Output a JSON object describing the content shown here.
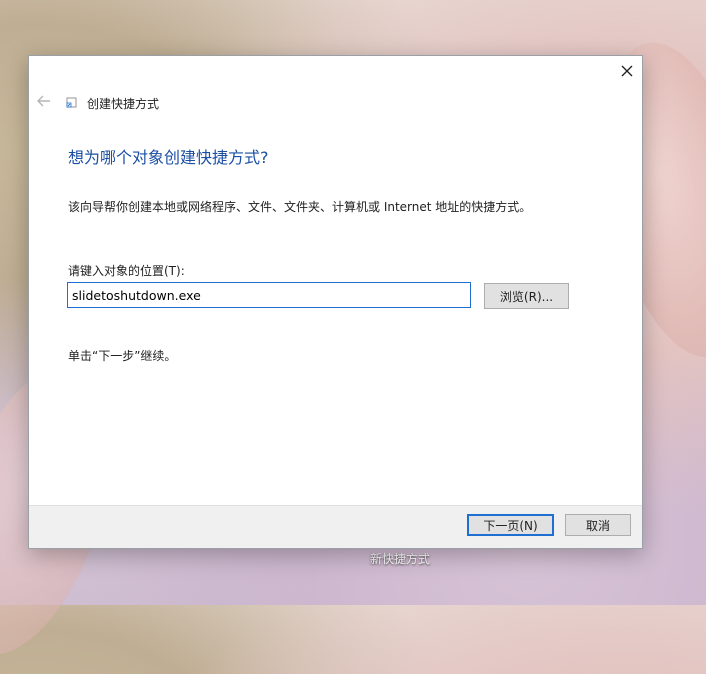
{
  "dialog": {
    "title": "创建快捷方式",
    "heading": "想为哪个对象创建快捷方式?",
    "description": "该向导帮你创建本地或网络程序、文件、文件夹、计算机或 Internet 地址的快捷方式。",
    "field_label": "请键入对象的位置(T):",
    "target_value": "slidetoshutdown.exe",
    "browse_label": "浏览(R)...",
    "hint": "单击“下一步”继续。",
    "next_label": "下一页(N)",
    "cancel_label": "取消"
  },
  "desktop": {
    "shortcut_label": "新快捷方式"
  },
  "icons": {
    "close": "close-icon",
    "back": "back-arrow-icon",
    "title": "shortcut-icon"
  },
  "colors": {
    "accent": "#1e6fd1",
    "heading": "#1b4fa3"
  }
}
